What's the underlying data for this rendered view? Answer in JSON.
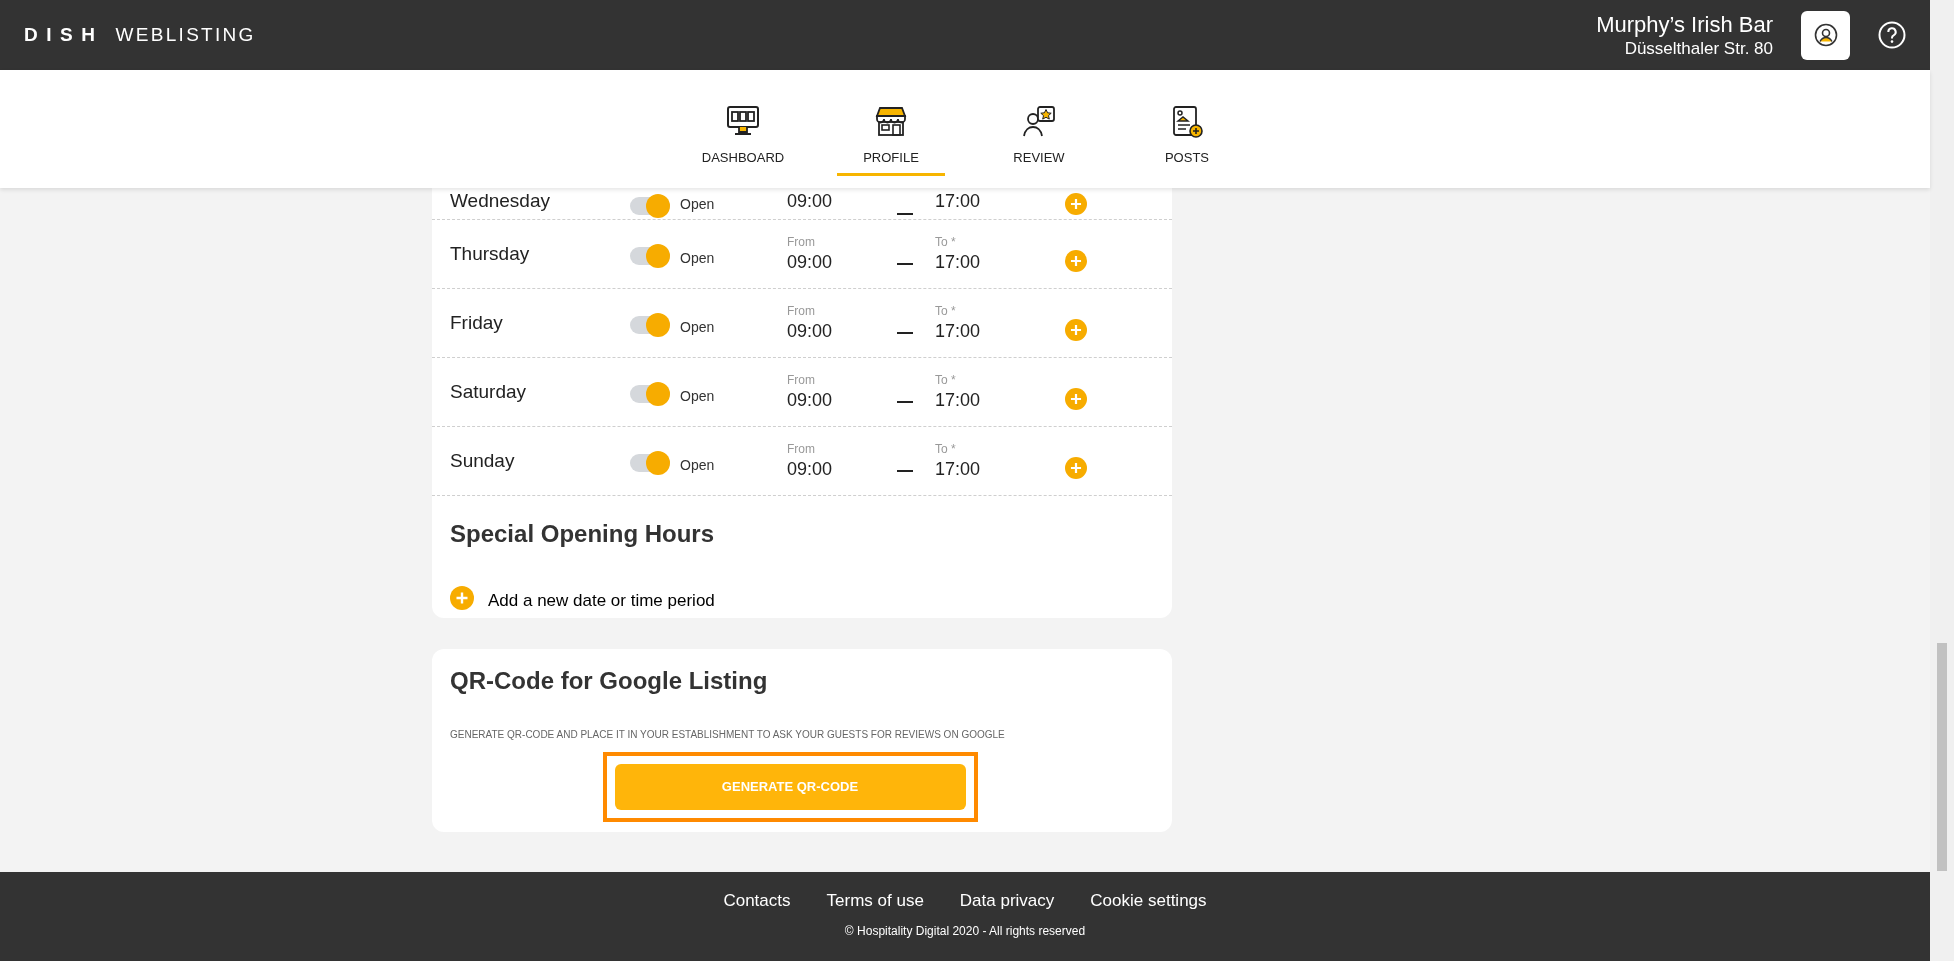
{
  "header": {
    "logo_bold": "DISH",
    "logo_text": "WEBLISTING",
    "venue_name": "Murphy’s Irish Bar",
    "venue_address": "Düsselthaler Str. 80"
  },
  "nav": [
    {
      "label": "DASHBOARD",
      "kind": "dashboard",
      "selected": false
    },
    {
      "label": "PROFILE",
      "kind": "profile",
      "selected": true
    },
    {
      "label": "REVIEW",
      "kind": "review",
      "selected": false
    },
    {
      "label": "POSTS",
      "kind": "posts",
      "selected": false
    }
  ],
  "opening_hours": [
    {
      "day": "Wednesday",
      "open": true,
      "status": "Open",
      "from": "09:00",
      "to": "17:00"
    },
    {
      "day": "Thursday",
      "open": true,
      "status": "Open",
      "from_label": "From",
      "from": "09:00",
      "to_label": "To *",
      "to": "17:00"
    },
    {
      "day": "Friday",
      "open": true,
      "status": "Open",
      "from_label": "From",
      "from": "09:00",
      "to_label": "To *",
      "to": "17:00"
    },
    {
      "day": "Saturday",
      "open": true,
      "status": "Open",
      "from_label": "From",
      "from": "09:00",
      "to_label": "To *",
      "to": "17:00"
    },
    {
      "day": "Sunday",
      "open": true,
      "status": "Open",
      "from_label": "From",
      "from": "09:00",
      "to_label": "To *",
      "to": "17:00"
    }
  ],
  "special_hours": {
    "title": "Special Opening Hours",
    "add_label": "Add a new date or time period"
  },
  "qr_card": {
    "title": "QR-Code for Google Listing",
    "description": "GENERATE QR-CODE AND PLACE IT IN YOUR ESTABLISHMENT TO ASK YOUR GUESTS FOR REVIEWS ON GOOGLE",
    "button": "GENERATE QR-CODE",
    "highlighted": true
  },
  "footer": {
    "links": [
      "Contacts",
      "Terms of use",
      "Data privacy",
      "Cookie settings"
    ],
    "copyright": "© Hospitality Digital 2020 - All rights reserved"
  }
}
